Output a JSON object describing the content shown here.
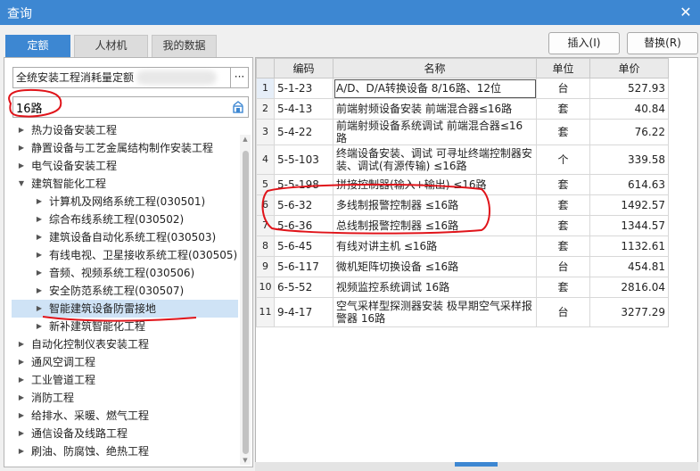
{
  "window": {
    "title": "查询"
  },
  "tabs": [
    {
      "label": "定额"
    },
    {
      "label": "人材机"
    },
    {
      "label": "我的数据"
    }
  ],
  "toolbar": {
    "insert_label": "插入(I)",
    "replace_label": "替换(R)"
  },
  "library": {
    "value": "全统安装工程消耗量定额",
    "more_label": "···"
  },
  "search": {
    "value": "16路"
  },
  "tree": [
    {
      "label": "热力设备安装工程",
      "level": 0,
      "expanded": false
    },
    {
      "label": "静置设备与工艺金属结构制作安装工程",
      "level": 0,
      "expanded": false
    },
    {
      "label": "电气设备安装工程",
      "level": 0,
      "expanded": false
    },
    {
      "label": "建筑智能化工程",
      "level": 0,
      "expanded": true
    },
    {
      "label": "计算机及网络系统工程(030501)",
      "level": 1,
      "expanded": false
    },
    {
      "label": "综合布线系统工程(030502)",
      "level": 1,
      "expanded": false
    },
    {
      "label": "建筑设备自动化系统工程(030503)",
      "level": 1,
      "expanded": false
    },
    {
      "label": "有线电视、卫星接收系统工程(030505)",
      "level": 1,
      "expanded": false
    },
    {
      "label": "音频、视频系统工程(030506)",
      "level": 1,
      "expanded": false
    },
    {
      "label": "安全防范系统工程(030507)",
      "level": 1,
      "expanded": false
    },
    {
      "label": "智能建筑设备防雷接地",
      "level": 1,
      "expanded": false,
      "selected": true
    },
    {
      "label": "新补建筑智能化工程",
      "level": 1,
      "expanded": false
    },
    {
      "label": "自动化控制仪表安装工程",
      "level": 0,
      "expanded": false
    },
    {
      "label": "通风空调工程",
      "level": 0,
      "expanded": false
    },
    {
      "label": "工业管道工程",
      "level": 0,
      "expanded": false
    },
    {
      "label": "消防工程",
      "level": 0,
      "expanded": false
    },
    {
      "label": "给排水、采暖、燃气工程",
      "level": 0,
      "expanded": false
    },
    {
      "label": "通信设备及线路工程",
      "level": 0,
      "expanded": false
    },
    {
      "label": "刷油、防腐蚀、绝热工程",
      "level": 0,
      "expanded": false
    }
  ],
  "table": {
    "columns": [
      "编码",
      "名称",
      "单位",
      "单价"
    ],
    "rows": [
      {
        "index": "1",
        "code": "5-1-23",
        "name": "A/D、D/A转换设备 8/16路、12位",
        "unit": "台",
        "price": "527.93"
      },
      {
        "index": "2",
        "code": "5-4-13",
        "name": "前端射频设备安装 前端混合器≤16路",
        "unit": "套",
        "price": "40.84"
      },
      {
        "index": "3",
        "code": "5-4-22",
        "name": "前端射频设备系统调试 前端混合器≤16路",
        "unit": "套",
        "price": "76.22"
      },
      {
        "index": "4",
        "code": "5-5-103",
        "name": "终端设备安装、调试 可寻址终端控制器安装、调试(有源传输) ≤16路",
        "unit": "个",
        "price": "339.58"
      },
      {
        "index": "5",
        "code": "5-5-198",
        "name": "拼接控制器(输入+输出) ≤16路",
        "unit": "套",
        "price": "614.63"
      },
      {
        "index": "6",
        "code": "5-6-32",
        "name": "多线制报警控制器 ≤16路",
        "unit": "套",
        "price": "1492.57"
      },
      {
        "index": "7",
        "code": "5-6-36",
        "name": "总线制报警控制器 ≤16路",
        "unit": "套",
        "price": "1344.57"
      },
      {
        "index": "8",
        "code": "5-6-45",
        "name": "有线对讲主机 ≤16路",
        "unit": "套",
        "price": "1132.61"
      },
      {
        "index": "9",
        "code": "5-6-117",
        "name": "微机矩阵切换设备 ≤16路",
        "unit": "台",
        "price": "454.81"
      },
      {
        "index": "10",
        "code": "6-5-52",
        "name": "视频监控系统调试 16路",
        "unit": "套",
        "price": "2816.04"
      },
      {
        "index": "11",
        "code": "9-4-17",
        "name": "空气采样型探测器安装 极早期空气采样报警器 16路",
        "unit": "台",
        "price": "3277.29"
      }
    ]
  },
  "colors": {
    "accent": "#3d87d2",
    "annotation": "#e0141a"
  }
}
